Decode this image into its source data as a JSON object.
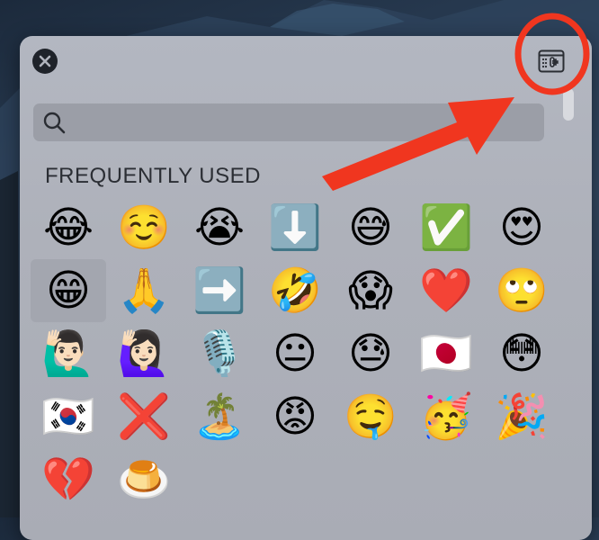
{
  "search": {
    "value": "",
    "placeholder": ""
  },
  "section": {
    "title": "FREQUENTLY USED"
  },
  "emojis": [
    "😂",
    "☺️",
    "😭",
    "⬇️",
    "😅",
    "✅",
    "😍",
    "😁",
    "🙏",
    "➡️",
    "🤣",
    "😱",
    "❤️",
    "🙄",
    "🙋🏻‍♂️",
    "🙋🏻‍♀️",
    "🎙️",
    "😐",
    "😓",
    "🇯🇵",
    "😳",
    "🇰🇷",
    "❌",
    "🏝️",
    "😡",
    "🤤",
    "🥳",
    "🎉",
    "💔",
    "🍮"
  ],
  "selected_index": 7,
  "colors": {
    "annotation_red": "#f0361f",
    "panel": "#b0b3bc",
    "search_field": "#9b9ea7",
    "section_text": "#2b2e34"
  },
  "icons": {
    "close": "close-icon",
    "character_viewer": "character-viewer-icon",
    "search": "search-icon"
  }
}
